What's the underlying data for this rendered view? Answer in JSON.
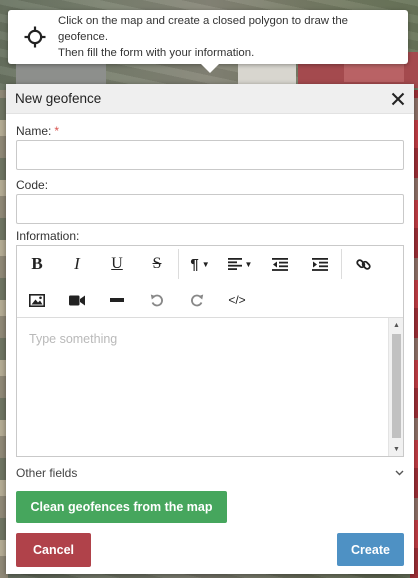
{
  "hint": {
    "text_line1": "Click on the map and create a closed polygon to draw the geofence.",
    "text_line2": "Then fill the form with your information."
  },
  "panel": {
    "title": "New geofence",
    "fields": {
      "name": {
        "label": "Name:",
        "required_marker": "*",
        "value": ""
      },
      "code": {
        "label": "Code:",
        "value": ""
      },
      "information": {
        "label": "Information:",
        "placeholder": "Type something"
      }
    },
    "toolbar": {
      "bold": "B",
      "italic": "I",
      "underline": "U",
      "strike": "S",
      "paragraph": "¶",
      "code_view": "</>"
    },
    "other_fields_label": "Other fields",
    "clean_button": "Clean geofences from the map",
    "cancel_button": "Cancel",
    "create_button": "Create"
  },
  "colors": {
    "clean_button": "#46a65d",
    "cancel_button": "#b0424a",
    "create_button": "#4e91c4",
    "required": "#d9534f"
  }
}
